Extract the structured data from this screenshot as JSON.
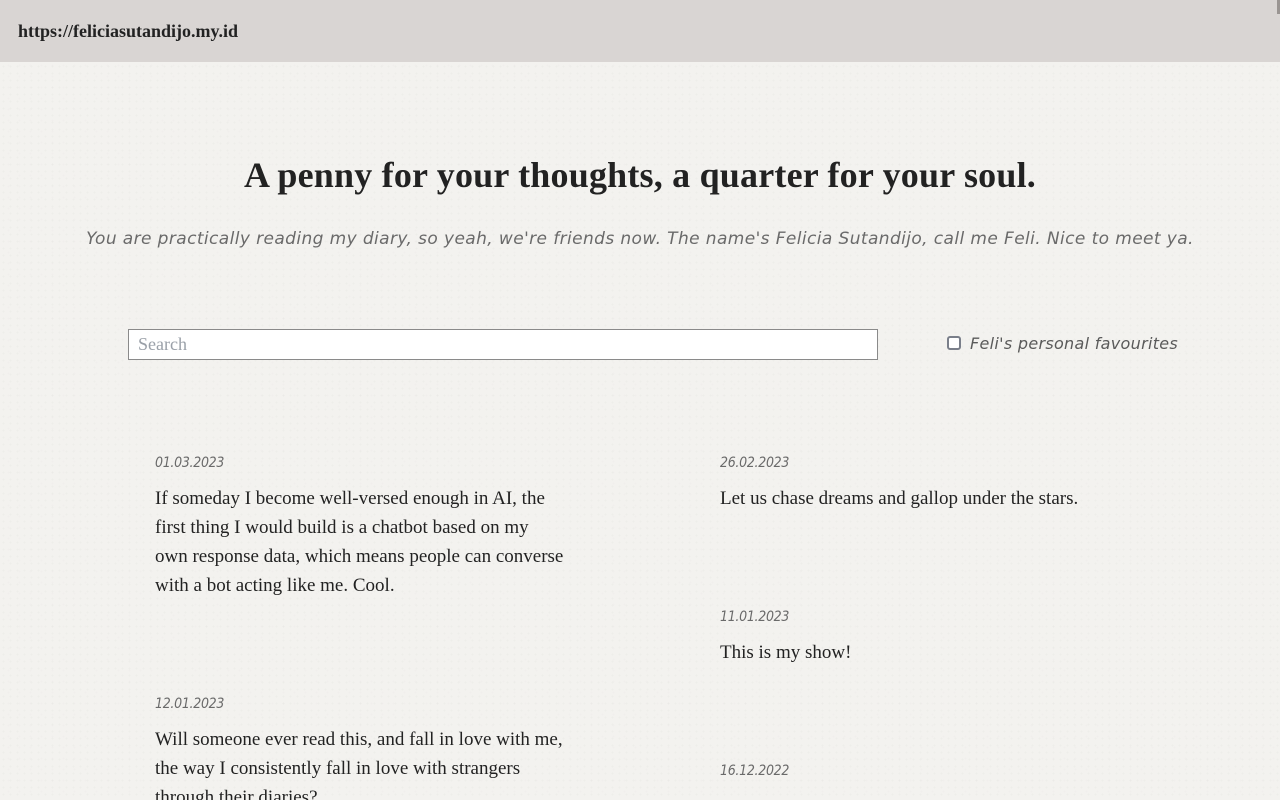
{
  "browser": {
    "url": "https://feliciasutandijo.my.id"
  },
  "hero": {
    "title": "A penny for your thoughts, a quarter for your soul.",
    "subtitle": "You are practically reading my diary, so yeah, we're friends now. The name's Felicia Sutandijo, call me Feli. Nice to meet ya."
  },
  "search": {
    "placeholder": "Search",
    "value": ""
  },
  "favourites_filter": {
    "label": "Feli's personal favourites",
    "checked": false
  },
  "entries": [
    {
      "date": "01.03.2023",
      "text": "If someday I become well-versed enough in AI, the first thing I would build is a chatbot based on my own response data, which means people can converse with a bot acting like me. Cool."
    },
    {
      "date": "26.02.2023",
      "text": "Let us chase dreams and gallop under the stars."
    },
    {
      "date": "11.01.2023",
      "text": "This is my show!"
    },
    {
      "date": "12.01.2023",
      "text": "Will someone ever read this, and fall in love with me, the way I consistently fall in love with strangers through their diaries?"
    },
    {
      "date": "16.12.2022",
      "text": ""
    }
  ]
}
